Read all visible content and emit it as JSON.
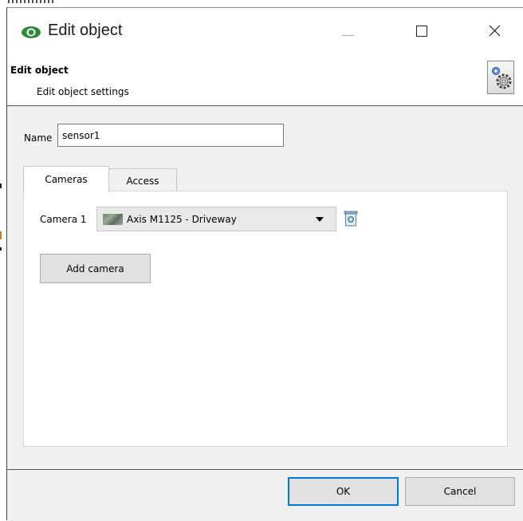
{
  "window": {
    "title": "Edit object",
    "minimize_icon": "minimize-icon",
    "maximize_icon": "maximize-icon",
    "close_icon": "close-icon",
    "app_icon": "eye-icon",
    "app_icon_color": "#2e8b3a"
  },
  "header": {
    "title": "Edit object",
    "subtitle": "Edit object settings",
    "icon": "settings-gears-icon"
  },
  "form": {
    "name_label": "Name",
    "name_value": "sensor1"
  },
  "tabs": [
    {
      "label": "Cameras",
      "active": true
    },
    {
      "label": "Access",
      "active": false
    }
  ],
  "cameras": {
    "rows": [
      {
        "label": "Camera 1",
        "selected": "Axis M1125 - Driveway"
      }
    ],
    "add_button": "Add camera"
  },
  "footer": {
    "ok_label": "OK",
    "cancel_label": "Cancel",
    "accent": "#0078d7"
  }
}
